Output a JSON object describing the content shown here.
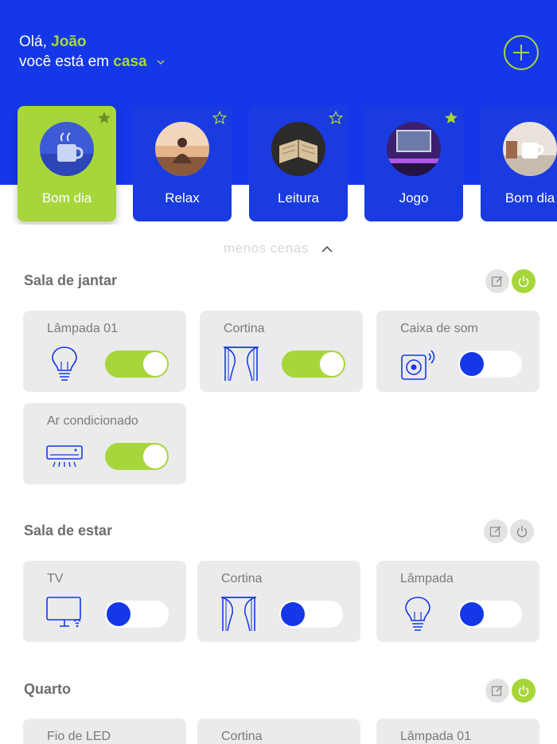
{
  "header": {
    "greeting_prefix": "Olá,",
    "user_name": "João",
    "location_prefix": "você está em",
    "location_name": "casa"
  },
  "scenes": [
    {
      "label": "Bom dia",
      "favorite": true,
      "active": true
    },
    {
      "label": "Relax",
      "favorite": false,
      "active": false
    },
    {
      "label": "Leitura",
      "favorite": false,
      "active": false
    },
    {
      "label": "Jogo",
      "favorite": true,
      "active": false
    },
    {
      "label": "Bom dia",
      "favorite": false,
      "active": false
    }
  ],
  "less_scenes_label": "menos cenas",
  "rooms": [
    {
      "title": "Sala de jantar",
      "power_on": true,
      "devices": [
        {
          "name": "Lâmpada 01",
          "icon": "lightbulb-icon",
          "on": true
        },
        {
          "name": "Cortina",
          "icon": "curtain-icon",
          "on": true
        },
        {
          "name": "Caixa de som",
          "icon": "speaker-icon",
          "on": false
        },
        {
          "name": "Ar condicionado",
          "icon": "air-conditioner-icon",
          "on": true
        }
      ]
    },
    {
      "title": "Sala de estar",
      "power_on": false,
      "devices": [
        {
          "name": "TV",
          "icon": "tv-icon",
          "on": false
        },
        {
          "name": "Cortina",
          "icon": "curtain-icon",
          "on": false
        },
        {
          "name": "Lâmpada",
          "icon": "lightbulb-icon",
          "on": false
        }
      ]
    },
    {
      "title": "Quarto",
      "power_on": true,
      "devices": [
        {
          "name": "Fio de LED",
          "icon": "led-strip-icon",
          "on": false
        },
        {
          "name": "Cortina",
          "icon": "curtain-icon",
          "on": false
        },
        {
          "name": "Lâmpada 01",
          "icon": "lightbulb-icon",
          "on": false
        }
      ]
    }
  ],
  "colors": {
    "brand_blue": "#1438e8",
    "accent_green": "#a7d63a",
    "card_gray": "#ebebeb"
  }
}
